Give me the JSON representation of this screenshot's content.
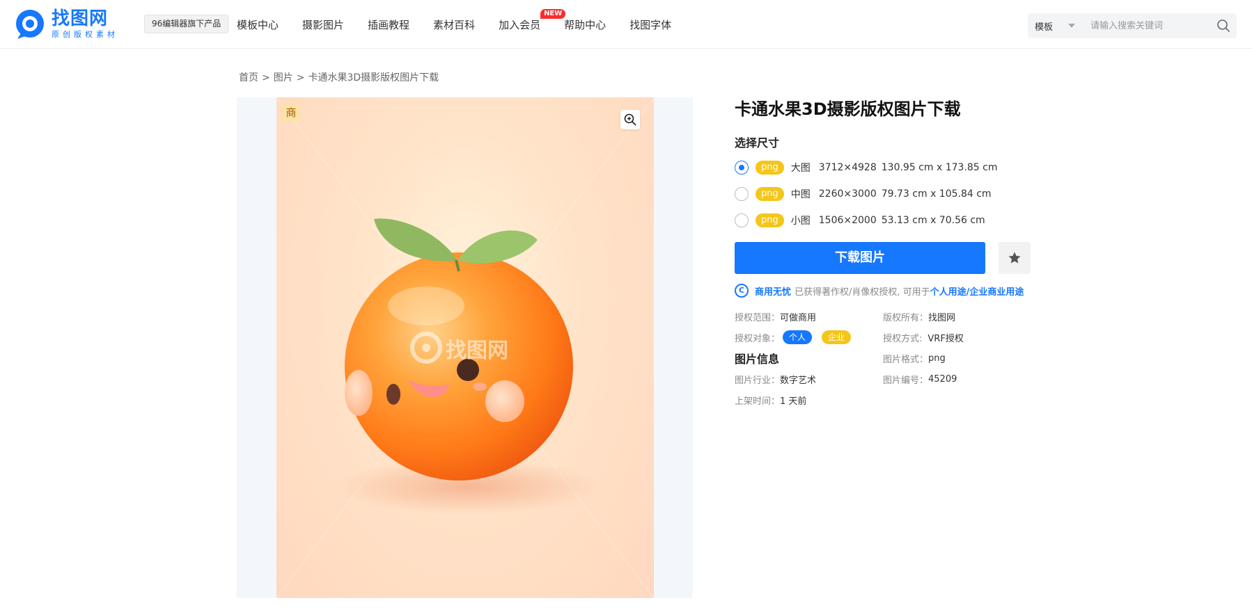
{
  "header": {
    "logo_title": "找图网",
    "logo_sub": "原创版权素材",
    "badge": "96编辑器旗下产品",
    "nav": [
      "模板中心",
      "摄影图片",
      "插画教程",
      "素材百科",
      "加入会员",
      "帮助中心",
      "找图字体"
    ],
    "new_badge": "NEW",
    "search_category": "模板",
    "search_placeholder": "请输入搜索关键词"
  },
  "breadcrumb": {
    "home": "首页",
    "sep": ">",
    "category": "图片",
    "current": "卡通水果3D摄影版权图片下载"
  },
  "preview": {
    "tag": "商",
    "watermark": "找图网"
  },
  "info": {
    "title": "卡通水果3D摄影版权图片下载",
    "size_label": "选择尺寸",
    "sizes": [
      {
        "format": "png",
        "name": "大图",
        "px": "3712×4928",
        "cm": "130.95 cm x 173.85 cm"
      },
      {
        "format": "png",
        "name": "中图",
        "px": "2260×3000",
        "cm": "79.73 cm x 105.84 cm"
      },
      {
        "format": "png",
        "name": "小图",
        "px": "1506×2000",
        "cm": "53.13 cm x 70.56 cm"
      }
    ],
    "download_label": "下载图片",
    "license_icon": "C",
    "license_strong": "商用无忧",
    "license_text": "已获得著作权/肖像权授权, 可用于",
    "license_link": "个人用途/企业商业用途",
    "meta": {
      "scope_k": "授权范围：",
      "scope_v": "可做商用",
      "owner_k": "版权所有：",
      "owner_v": "找图网",
      "target_k": "授权对象：",
      "target_personal": "个人",
      "target_company": "企业",
      "method_k": "授权方式:",
      "method_v": "VRF授权",
      "info_heading": "图片信息",
      "format_k": "图片格式：",
      "format_v": "png",
      "industry_k": "图片行业：",
      "industry_v": "数字艺术",
      "id_k": "图片编号：",
      "id_v": "45209",
      "time_k": "上架时间：",
      "time_v": "1 天前"
    }
  },
  "colors": {
    "brand": "#1677ff",
    "png_tag": "#f5c518"
  }
}
